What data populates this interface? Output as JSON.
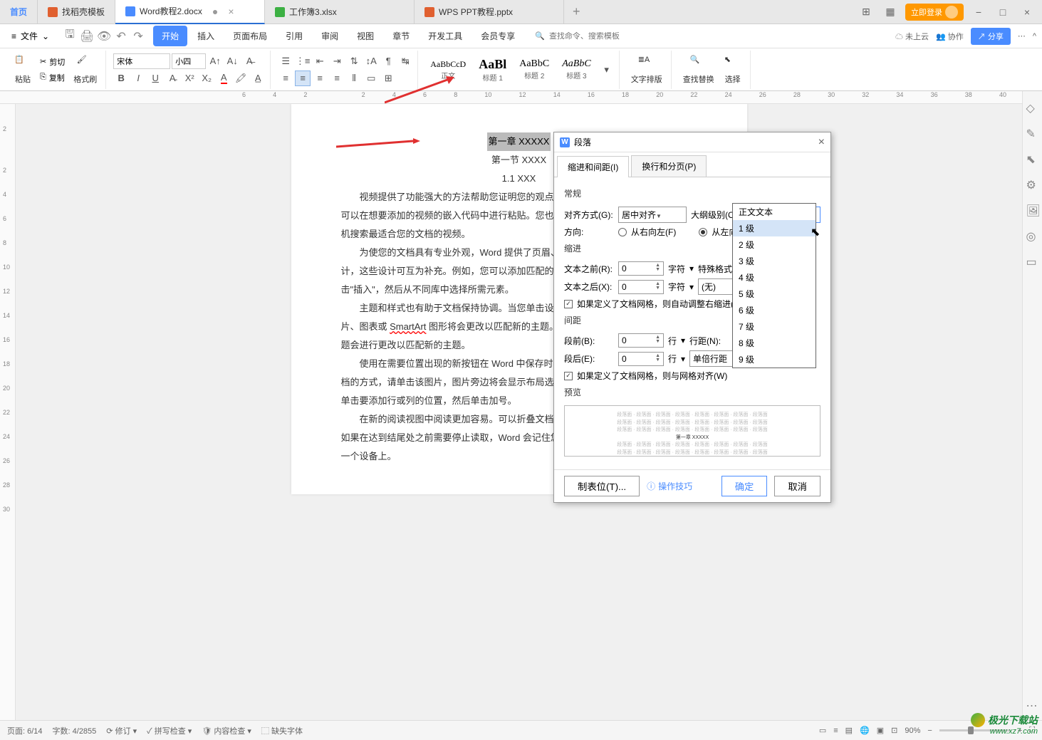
{
  "tabs": {
    "home": "首页",
    "t1": "找稻壳模板",
    "t2": "Word教程2.docx",
    "t3": "工作簿3.xlsx",
    "t4": "WPS PPT教程.pptx"
  },
  "login_btn": "立即登录",
  "menu": {
    "file": "文件",
    "tabs": [
      "开始",
      "插入",
      "页面布局",
      "引用",
      "审阅",
      "视图",
      "章节",
      "开发工具",
      "会员专享"
    ],
    "search_hint": "查找命令、搜索模板",
    "not_cloud": "未上云",
    "collab": "协作",
    "share": "分享"
  },
  "ribbon": {
    "paste": "粘贴",
    "cut": "剪切",
    "copy": "复制",
    "format_painter": "格式刷",
    "font_name": "宋体",
    "font_size": "小四",
    "styles": [
      {
        "preview": "AaBbCcD",
        "label": "正文"
      },
      {
        "preview": "AaBl",
        "label": "标题 1"
      },
      {
        "preview": "AaBbC",
        "label": "标题 2"
      },
      {
        "preview": "AaBbC",
        "label": "标题 3"
      }
    ],
    "word_layout": "文字排版",
    "find_replace": "查找替换",
    "select": "选择"
  },
  "ruler_h": [
    "6",
    "4",
    "2",
    "",
    "2",
    "4",
    "6",
    "8",
    "10",
    "12",
    "14",
    "16",
    "18",
    "20",
    "22",
    "24",
    "26",
    "28",
    "30",
    "32",
    "34",
    "36",
    "38",
    "40"
  ],
  "ruler_v": [
    "2",
    "",
    "2",
    "4",
    "6",
    "8",
    "10",
    "12",
    "14",
    "16",
    "18",
    "20",
    "22",
    "24",
    "26",
    "28",
    "30"
  ],
  "doc": {
    "h1": "第一章  XXXXX",
    "h2": "第一节  XXXX",
    "h3": "1.1 XXX",
    "p1a": "视频提供了功能强大的方法帮助您证明您的观点。当您单击",
    "p1b": "可以在想要添加的视频的嵌入代码中进行粘贴。您也可以键入一",
    "p1c": "机搜索最适合您的文档的视频。",
    "p2a": "为使您的文档具有专业外观，Word 提供了页眉、页脚、封面",
    "p2b": "计，这些设计可互为补充。例如，您可以添加匹配的封面、页眉",
    "p2c": "击\"插入\"，然后从不同库中选择所需元素。",
    "p3a": "主题和样式也有助于文档保持协调。当您单击设计并选择新",
    "p3b_pre": "片、图表或 ",
    "p3b_wavy": "SmartArt",
    "p3b_post": " 图形将会更改以匹配新的主题。当应用样式",
    "p3c": "题会进行更改以匹配新的主题。",
    "p4a": "使用在需要位置出现的新按钮在 Word 中保存时间。若要更",
    "p4b": "档的方式，请单击该图片，图片旁边将会显示布局选项按钮。当",
    "p4c": "单击要添加行或列的位置，然后单击加号。",
    "p5a": "在新的阅读视图中阅读更加容易。可以折叠文档某些部分并",
    "p5b": "如果在达到结尾处之前需要停止读取，Word 会记住您的停止位置",
    "p5c": "一个设备上。"
  },
  "dialog": {
    "title": "段落",
    "tab1": "缩进和间距(I)",
    "tab2": "换行和分页(P)",
    "sec_general": "常规",
    "align_label": "对齐方式(G):",
    "align_value": "居中对齐",
    "outline_label": "大纲级别(O):",
    "outline_value": "1 级",
    "dir_label": "方向:",
    "dir_rtl": "从右向左(F)",
    "dir_ltr": "从左向右(L)",
    "sec_indent": "缩进",
    "before_text": "文本之前(R):",
    "after_text": "文本之后(X):",
    "unit_char": "字符",
    "special_label": "特殊格式(S):",
    "special_value": "(无)",
    "indent_val": "0",
    "auto_indent": "如果定义了文档网格，则自动调整右缩进(D)",
    "sec_spacing": "间距",
    "before_para": "段前(B):",
    "after_para": "段后(E):",
    "unit_line": "行",
    "line_spacing_label": "行距(N):",
    "line_spacing_value": "单倍行距",
    "spacing_val": "0",
    "grid_align": "如果定义了文档网格，则与网格对齐(W)",
    "sec_preview": "预览",
    "preview_filler": "段落面 · 段落面 · 段落面 · 段落面 · 段落面 · 段落面 · 段落面 · 段落面",
    "preview_center": "第一章 XXXXX",
    "tab_stops": "制表位(T)...",
    "op_tips": "操作技巧",
    "ok": "确定",
    "cancel": "取消"
  },
  "dropdown_opts": [
    "正文文本",
    "1 级",
    "2 级",
    "3 级",
    "4 级",
    "5 级",
    "6 级",
    "7 级",
    "8 级",
    "9 级"
  ],
  "status": {
    "page": "页面: 6/14",
    "words": "字数: 4/2855",
    "revision": "修订",
    "spell": "拼写检查",
    "content": "内容检查",
    "missing_font": "缺失字体",
    "zoom": "90%"
  },
  "watermark": {
    "line1": "极光下载站",
    "line2": "www.xz7.com"
  }
}
